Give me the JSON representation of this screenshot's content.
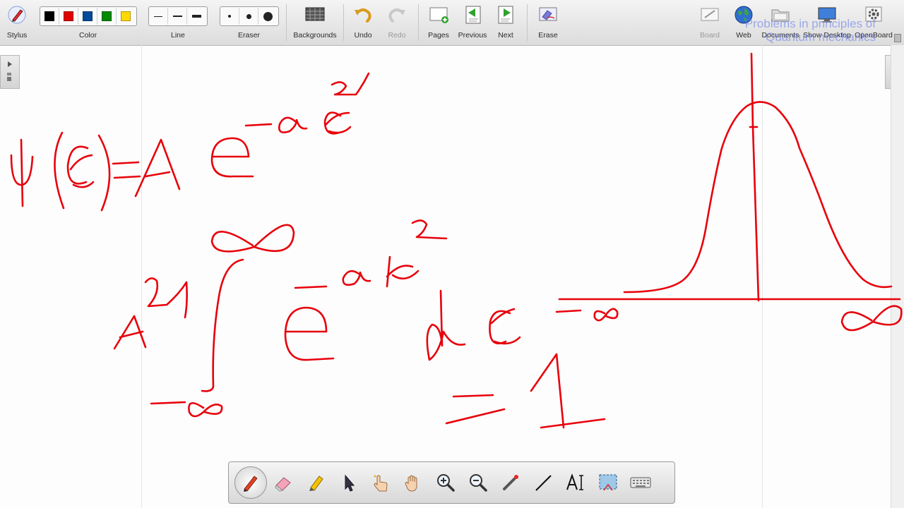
{
  "toolbar": {
    "stylus_label": "Stylus",
    "color_label": "Color",
    "line_label": "Line",
    "eraser_label": "Eraser",
    "backgrounds_label": "Backgrounds",
    "undo_label": "Undo",
    "redo_label": "Redo",
    "pages_label": "Pages",
    "previous_label": "Previous",
    "next_label": "Next",
    "erase_label": "Erase",
    "board_label": "Board",
    "web_label": "Web",
    "documents_label": "Documents",
    "show_desktop_label": "Show Desktop",
    "openboard_label": "OpenBoard",
    "colors": [
      "#000000",
      "#e00000",
      "#004a99",
      "#008a00",
      "#ffd800"
    ]
  },
  "overlay": {
    "line1": "Problems in principles of",
    "line2": "Quantum mechanics"
  },
  "board": {
    "ink_color": "#e8000b"
  },
  "bottom_tools": [
    {
      "name": "pen-tool",
      "icon": "pen-icon",
      "active": true
    },
    {
      "name": "eraser-tool",
      "icon": "eraser-icon"
    },
    {
      "name": "highlighter-tool",
      "icon": "highlighter-icon"
    },
    {
      "name": "select-tool",
      "icon": "arrow-pointer-icon"
    },
    {
      "name": "interact-tool",
      "icon": "pointing-hand-icon"
    },
    {
      "name": "hand-tool",
      "icon": "hand-icon"
    },
    {
      "name": "zoom-in-tool",
      "icon": "zoom-in-icon"
    },
    {
      "name": "zoom-out-tool",
      "icon": "zoom-out-icon"
    },
    {
      "name": "laser-tool",
      "icon": "laser-pointer-icon"
    },
    {
      "name": "line-tool",
      "icon": "line-icon"
    },
    {
      "name": "text-tool",
      "icon": "text-icon"
    },
    {
      "name": "capture-tool",
      "icon": "capture-icon"
    },
    {
      "name": "keyboard-tool",
      "icon": "keyboard-icon"
    }
  ]
}
